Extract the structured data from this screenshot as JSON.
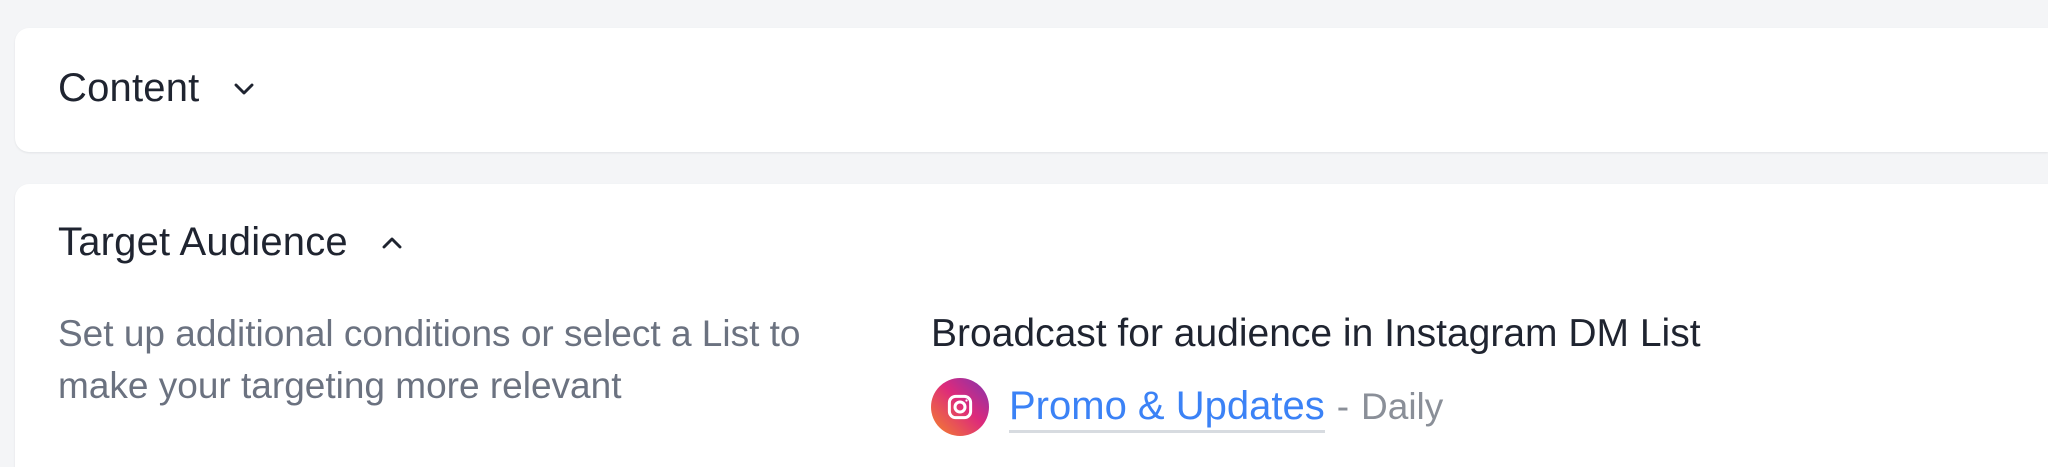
{
  "content_section": {
    "title": "Content",
    "chevron": "chevron-down-icon"
  },
  "audience_section": {
    "title": "Target Audience",
    "chevron": "chevron-up-icon",
    "description": "Set up additional conditions or select a List to make your targeting more relevant",
    "broadcast_title": "Broadcast for audience in Instagram DM List",
    "list": {
      "icon": "instagram-icon",
      "name": "Promo & Updates",
      "separator": "-",
      "frequency": "Daily"
    }
  },
  "colors": {
    "background": "#f4f5f7",
    "card": "#ffffff",
    "text_primary": "#1f2430",
    "text_secondary": "#6b7280",
    "link": "#3b82f6"
  }
}
